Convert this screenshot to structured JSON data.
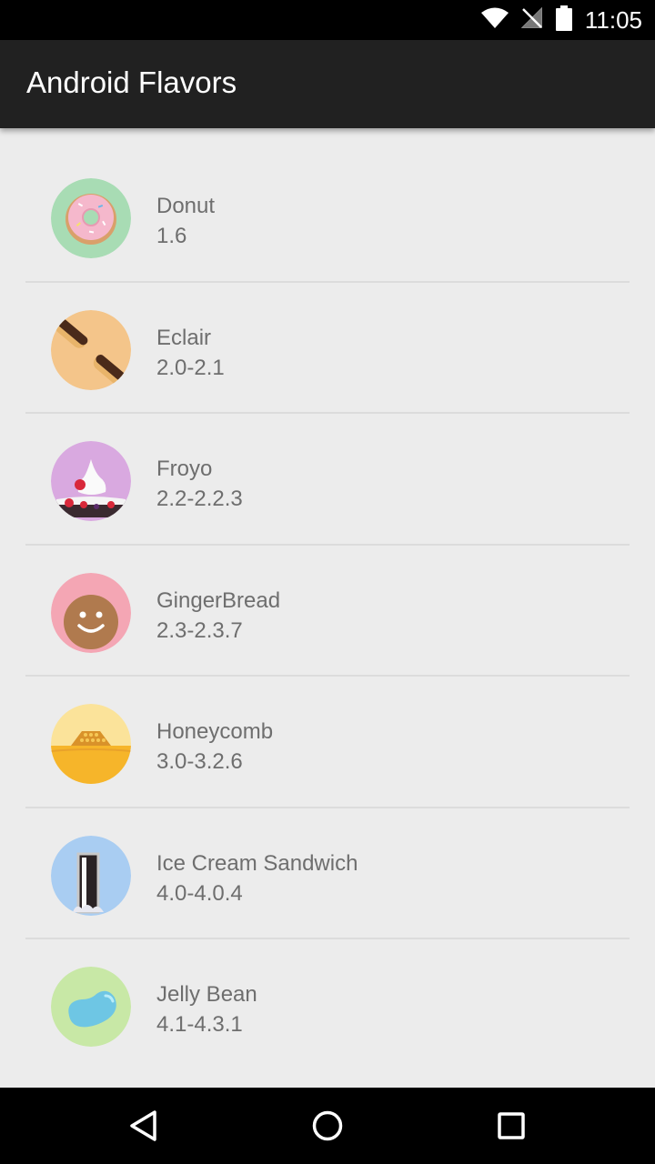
{
  "status_bar": {
    "time": "11:05",
    "icons": [
      "wifi-icon",
      "no-signal-icon",
      "battery-icon"
    ]
  },
  "app_bar": {
    "title": "Android Flavors"
  },
  "flavors": [
    {
      "name": "Donut",
      "version": "1.6",
      "icon": "donut-icon",
      "color": "#a8dcb4"
    },
    {
      "name": "Eclair",
      "version": "2.0-2.1",
      "icon": "eclair-icon",
      "color": "#f4c58a"
    },
    {
      "name": "Froyo",
      "version": "2.2-2.2.3",
      "icon": "froyo-icon",
      "color": "#d9a9e0"
    },
    {
      "name": "GingerBread",
      "version": "2.3-2.3.7",
      "icon": "gingerbread-icon",
      "color": "#f4a6b4"
    },
    {
      "name": "Honeycomb",
      "version": "3.0-3.2.6",
      "icon": "honeycomb-icon",
      "color": "#fbe39a"
    },
    {
      "name": "Ice Cream Sandwich",
      "version": "4.0-4.0.4",
      "icon": "ice-cream-sandwich-icon",
      "color": "#a9cdf2"
    },
    {
      "name": "Jelly Bean",
      "version": "4.1-4.3.1",
      "icon": "jelly-bean-icon",
      "color": "#c8e8a6"
    }
  ],
  "nav_bar": {
    "buttons": [
      "back-icon",
      "home-icon",
      "recents-icon"
    ]
  }
}
